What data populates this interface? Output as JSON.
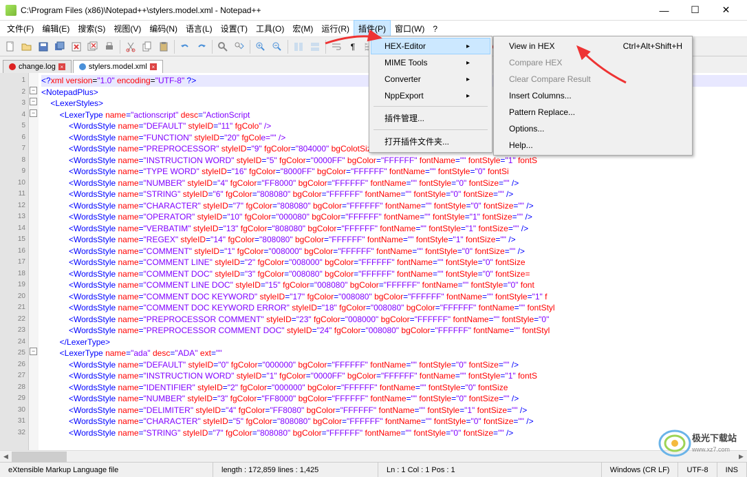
{
  "title": "C:\\Program Files (x86)\\Notepad++\\stylers.model.xml - Notepad++",
  "menu": {
    "file": "文件(F)",
    "edit": "编辑(E)",
    "search": "搜索(S)",
    "view": "视图(V)",
    "encode": "编码(N)",
    "lang": "语言(L)",
    "settings": "设置(T)",
    "tools": "工具(O)",
    "macro": "宏(M)",
    "run": "运行(R)",
    "plugins": "插件(P)",
    "window": "窗口(W)",
    "help": "?"
  },
  "tabs": [
    {
      "name": "change.log",
      "close": true
    },
    {
      "name": "stylers.model.xml",
      "close": true
    }
  ],
  "plugin_menu": {
    "hex": "HEX-Editor",
    "mime": "MIME Tools",
    "conv": "Converter",
    "npp": "NppExport",
    "mgr": "插件管理...",
    "open": "打开插件文件夹..."
  },
  "hex_submenu": {
    "view": "View in HEX",
    "shortcut": "Ctrl+Alt+Shift+H",
    "compare": "Compare HEX",
    "clear": "Clear Compare Result",
    "insert": "Insert Columns...",
    "pattern": "Pattern Replace...",
    "options": "Options...",
    "help": "Help..."
  },
  "lines": [
    {
      "n": 1,
      "c": "<?xml version=\"1.0\" encoding=\"UTF-8\" ?>",
      "t": "dec",
      "hl": true
    },
    {
      "n": 2,
      "c": "<NotepadPlus>",
      "t": "tag",
      "i": 0
    },
    {
      "n": 3,
      "c": "<LexerStyles>",
      "t": "tag",
      "i": 1
    },
    {
      "n": 4,
      "raw": "<LexerType name=\"actionscript\" desc=\"ActionScript",
      "i": 2
    },
    {
      "n": 5,
      "raw": "<WordsStyle name=\"DEFAULT\" styleID=\"11\" fgColo",
      "tail": "\" />",
      "i": 3
    },
    {
      "n": 6,
      "raw": "<WordsStyle name=\"FUNCTION\" styleID=\"20\" fgCol",
      "tail": "e=\"\" />",
      "i": 3
    },
    {
      "n": 7,
      "parts": [
        [
          "WordsStyle"
        ],
        [
          "name",
          "PREPROCESSOR"
        ],
        [
          "styleID",
          "9"
        ],
        [
          "fgColor",
          "804000"
        ],
        [
          "bgColo"
        ]
      ],
      "tail": "tSize=",
      "i": 3
    },
    {
      "n": 8,
      "parts": [
        [
          "WordsStyle"
        ],
        [
          "name",
          "INSTRUCTION WORD"
        ],
        [
          "styleID",
          "5"
        ],
        [
          "fgColor",
          "0000FF"
        ],
        [
          "bgColor",
          "FFFFFF"
        ],
        [
          "fontName",
          ""
        ],
        [
          "fontStyle",
          "1"
        ]
      ],
      "tail": " fontS",
      "i": 3
    },
    {
      "n": 9,
      "parts": [
        [
          "WordsStyle"
        ],
        [
          "name",
          "TYPE WORD"
        ],
        [
          "styleID",
          "16"
        ],
        [
          "fgColor",
          "8000FF"
        ],
        [
          "bgColor",
          "FFFFFF"
        ],
        [
          "fontName",
          ""
        ],
        [
          "fontStyle",
          "0"
        ]
      ],
      "tail": " fontSi",
      "i": 3
    },
    {
      "n": 10,
      "parts": [
        [
          "WordsStyle"
        ],
        [
          "name",
          "NUMBER"
        ],
        [
          "styleID",
          "4"
        ],
        [
          "fgColor",
          "FF8000"
        ],
        [
          "bgColor",
          "FFFFFF"
        ],
        [
          "fontName",
          ""
        ],
        [
          "fontStyle",
          "0"
        ],
        [
          "fontSize",
          ""
        ]
      ],
      "close": true,
      "i": 3
    },
    {
      "n": 11,
      "parts": [
        [
          "WordsStyle"
        ],
        [
          "name",
          "STRING"
        ],
        [
          "styleID",
          "6"
        ],
        [
          "fgColor",
          "808080"
        ],
        [
          "bgColor",
          "FFFFFF"
        ],
        [
          "fontName",
          ""
        ],
        [
          "fontStyle",
          "0"
        ],
        [
          "fontSize",
          ""
        ]
      ],
      "close": true,
      "i": 3
    },
    {
      "n": 12,
      "parts": [
        [
          "WordsStyle"
        ],
        [
          "name",
          "CHARACTER"
        ],
        [
          "styleID",
          "7"
        ],
        [
          "fgColor",
          "808080"
        ],
        [
          "bgColor",
          "FFFFFF"
        ],
        [
          "fontName",
          ""
        ],
        [
          "fontStyle",
          "0"
        ],
        [
          "fontSize",
          ""
        ]
      ],
      "close": true,
      "i": 3
    },
    {
      "n": 13,
      "parts": [
        [
          "WordsStyle"
        ],
        [
          "name",
          "OPERATOR"
        ],
        [
          "styleID",
          "10"
        ],
        [
          "fgColor",
          "000080"
        ],
        [
          "bgColor",
          "FFFFFF"
        ],
        [
          "fontName",
          ""
        ],
        [
          "fontStyle",
          "1"
        ],
        [
          "fontSize",
          ""
        ]
      ],
      "close": true,
      "i": 3
    },
    {
      "n": 14,
      "parts": [
        [
          "WordsStyle"
        ],
        [
          "name",
          "VERBATIM"
        ],
        [
          "styleID",
          "13"
        ],
        [
          "fgColor",
          "808080"
        ],
        [
          "bgColor",
          "FFFFFF"
        ],
        [
          "fontName",
          ""
        ],
        [
          "fontStyle",
          "1"
        ],
        [
          "fontSize",
          ""
        ]
      ],
      "close": true,
      "i": 3
    },
    {
      "n": 15,
      "parts": [
        [
          "WordsStyle"
        ],
        [
          "name",
          "REGEX"
        ],
        [
          "styleID",
          "14"
        ],
        [
          "fgColor",
          "808080"
        ],
        [
          "bgColor",
          "FFFFFF"
        ],
        [
          "fontName",
          ""
        ],
        [
          "fontStyle",
          "1"
        ],
        [
          "fontSize",
          ""
        ]
      ],
      "close": true,
      "i": 3
    },
    {
      "n": 16,
      "parts": [
        [
          "WordsStyle"
        ],
        [
          "name",
          "COMMENT"
        ],
        [
          "styleID",
          "1"
        ],
        [
          "fgColor",
          "008000"
        ],
        [
          "bgColor",
          "FFFFFF"
        ],
        [
          "fontName",
          ""
        ],
        [
          "fontStyle",
          "0"
        ],
        [
          "fontSize",
          ""
        ]
      ],
      "close": true,
      "i": 3
    },
    {
      "n": 17,
      "parts": [
        [
          "WordsStyle"
        ],
        [
          "name",
          "COMMENT LINE"
        ],
        [
          "styleID",
          "2"
        ],
        [
          "fgColor",
          "008000"
        ],
        [
          "bgColor",
          "FFFFFF"
        ],
        [
          "fontName",
          ""
        ],
        [
          "fontStyle",
          "0"
        ]
      ],
      "tail": " fontSize",
      "i": 3
    },
    {
      "n": 18,
      "parts": [
        [
          "WordsStyle"
        ],
        [
          "name",
          "COMMENT DOC"
        ],
        [
          "styleID",
          "3"
        ],
        [
          "fgColor",
          "008080"
        ],
        [
          "bgColor",
          "FFFFFF"
        ],
        [
          "fontName",
          ""
        ],
        [
          "fontStyle",
          "0"
        ]
      ],
      "tail": " fontSize=",
      "i": 3
    },
    {
      "n": 19,
      "parts": [
        [
          "WordsStyle"
        ],
        [
          "name",
          "COMMENT LINE DOC"
        ],
        [
          "styleID",
          "15"
        ],
        [
          "fgColor",
          "008080"
        ],
        [
          "bgColor",
          "FFFFFF"
        ],
        [
          "fontName",
          ""
        ],
        [
          "fontStyle",
          "0"
        ]
      ],
      "tail": " font",
      "i": 3
    },
    {
      "n": 20,
      "parts": [
        [
          "WordsStyle"
        ],
        [
          "name",
          "COMMENT DOC KEYWORD"
        ],
        [
          "styleID",
          "17"
        ],
        [
          "fgColor",
          "008080"
        ],
        [
          "bgColor",
          "FFFFFF"
        ],
        [
          "fontName",
          ""
        ],
        [
          "fontStyle",
          "1"
        ]
      ],
      "tail": " f",
      "i": 3
    },
    {
      "n": 21,
      "parts": [
        [
          "WordsStyle"
        ],
        [
          "name",
          "COMMENT DOC KEYWORD ERROR"
        ],
        [
          "styleID",
          "18"
        ],
        [
          "fgColor",
          "008080"
        ],
        [
          "bgColor",
          "FFFFFF"
        ],
        [
          "fontName",
          ""
        ],
        [
          "fontStyl"
        ]
      ],
      "i": 3
    },
    {
      "n": 22,
      "parts": [
        [
          "WordsStyle"
        ],
        [
          "name",
          "PREPROCESSOR COMMENT"
        ],
        [
          "styleID",
          "23"
        ],
        [
          "fgColor",
          "008000"
        ],
        [
          "bgColor",
          "FFFFFF"
        ],
        [
          "fontName",
          ""
        ],
        [
          "fontStyle",
          "0"
        ]
      ],
      "tail": "",
      "i": 3
    },
    {
      "n": 23,
      "parts": [
        [
          "WordsStyle"
        ],
        [
          "name",
          "PREPROCESSOR COMMENT DOC"
        ],
        [
          "styleID",
          "24"
        ],
        [
          "fgColor",
          "008080"
        ],
        [
          "bgColor",
          "FFFFFF"
        ],
        [
          "fontName",
          ""
        ],
        [
          "fontStyl"
        ]
      ],
      "i": 3
    },
    {
      "n": 24,
      "c": "</LexerType>",
      "t": "end",
      "i": 2
    },
    {
      "n": 25,
      "parts": [
        [
          "LexerType"
        ],
        [
          "name",
          "ada"
        ],
        [
          "desc",
          "ADA"
        ],
        [
          "ext",
          ""
        ]
      ],
      "i": 2
    },
    {
      "n": 26,
      "parts": [
        [
          "WordsStyle"
        ],
        [
          "name",
          "DEFAULT"
        ],
        [
          "styleID",
          "0"
        ],
        [
          "fgColor",
          "000000"
        ],
        [
          "bgColor",
          "FFFFFF"
        ],
        [
          "fontName",
          ""
        ],
        [
          "fontStyle",
          "0"
        ],
        [
          "fontSize",
          ""
        ]
      ],
      "close": true,
      "i": 3
    },
    {
      "n": 27,
      "parts": [
        [
          "WordsStyle"
        ],
        [
          "name",
          "INSTRUCTION WORD"
        ],
        [
          "styleID",
          "1"
        ],
        [
          "fgColor",
          "0000FF"
        ],
        [
          "bgColor",
          "FFFFFF"
        ],
        [
          "fontName",
          ""
        ],
        [
          "fontStyle",
          "1"
        ]
      ],
      "tail": " fontS",
      "i": 3
    },
    {
      "n": 28,
      "parts": [
        [
          "WordsStyle"
        ],
        [
          "name",
          "IDENTIFIER"
        ],
        [
          "styleID",
          "2"
        ],
        [
          "fgColor",
          "000000"
        ],
        [
          "bgColor",
          "FFFFFF"
        ],
        [
          "fontName",
          ""
        ],
        [
          "fontStyle",
          "0"
        ]
      ],
      "tail": " fontSize",
      "i": 3
    },
    {
      "n": 29,
      "parts": [
        [
          "WordsStyle"
        ],
        [
          "name",
          "NUMBER"
        ],
        [
          "styleID",
          "3"
        ],
        [
          "fgColor",
          "FF8000"
        ],
        [
          "bgColor",
          "FFFFFF"
        ],
        [
          "fontName",
          ""
        ],
        [
          "fontStyle",
          "0"
        ],
        [
          "fontSize",
          ""
        ]
      ],
      "close": true,
      "i": 3
    },
    {
      "n": 30,
      "parts": [
        [
          "WordsStyle"
        ],
        [
          "name",
          "DELIMITER"
        ],
        [
          "styleID",
          "4"
        ],
        [
          "fgColor",
          "FF8080"
        ],
        [
          "bgColor",
          "FFFFFF"
        ],
        [
          "fontName",
          ""
        ],
        [
          "fontStyle",
          "1"
        ],
        [
          "fontSize",
          ""
        ]
      ],
      "close": true,
      "i": 3
    },
    {
      "n": 31,
      "parts": [
        [
          "WordsStyle"
        ],
        [
          "name",
          "CHARACTER"
        ],
        [
          "styleID",
          "5"
        ],
        [
          "fgColor",
          "808080"
        ],
        [
          "bgColor",
          "FFFFFF"
        ],
        [
          "fontName",
          ""
        ],
        [
          "fontStyle",
          "0"
        ],
        [
          "fontSize",
          ""
        ]
      ],
      "close": true,
      "i": 3
    },
    {
      "n": 32,
      "parts": [
        [
          "WordsStyle"
        ],
        [
          "name",
          "STRING"
        ],
        [
          "styleID",
          "7"
        ],
        [
          "fgColor",
          "808080"
        ],
        [
          "bgColor",
          "FFFFFF"
        ],
        [
          "fontName",
          ""
        ],
        [
          "fontStyle",
          "0"
        ],
        [
          "fontSize",
          ""
        ]
      ],
      "close": true,
      "i": 3
    }
  ],
  "status": {
    "lang": "eXtensible Markup Language file",
    "len": "length : 172,859    lines : 1,425",
    "pos": "Ln : 1    Col : 1    Pos : 1",
    "eol": "Windows (CR LF)",
    "enc": "UTF-8",
    "ins": "INS"
  },
  "logo": "极光下载站"
}
